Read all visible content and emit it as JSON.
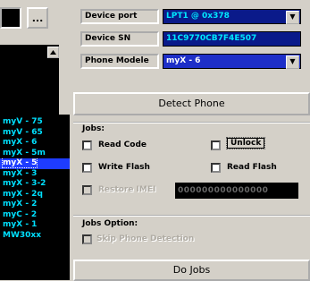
{
  "left": {
    "browse_label": "...",
    "models": [
      "myV - 75",
      "myV - 65",
      "myX - 6",
      "myX - 5m",
      "myX - 5",
      "myX - 3",
      "myX - 3-2",
      "myX - 2q",
      "myX - 2",
      "myC - 2",
      "myX - 1",
      "MW30xx"
    ],
    "selected_model_index": 4
  },
  "device": {
    "port_label": "Device port",
    "port_value": "LPT1 @ 0x378",
    "sn_label": "Device SN",
    "sn_value": "11C9770CB7F4E507",
    "model_label": "Phone Modele",
    "model_value": "myX - 6"
  },
  "buttons": {
    "detect": "Detect Phone",
    "do_jobs": "Do Jobs"
  },
  "jobs": {
    "title": "Jobs:",
    "read_code": "Read Code",
    "unlock": "Unlock",
    "write_flash": "Write Flash",
    "read_flash": "Read Flash",
    "restore_imei": "Restore IMEI",
    "imei_value": "000000000000000"
  },
  "options": {
    "title": "Jobs Option:",
    "skip_detection": "Skip Phone Detection"
  },
  "colors": {
    "window_bg": "#d4d0c8",
    "list_text": "#00e0ff",
    "selection": "#1e3cff",
    "field_bg": "#0a1a8a"
  }
}
